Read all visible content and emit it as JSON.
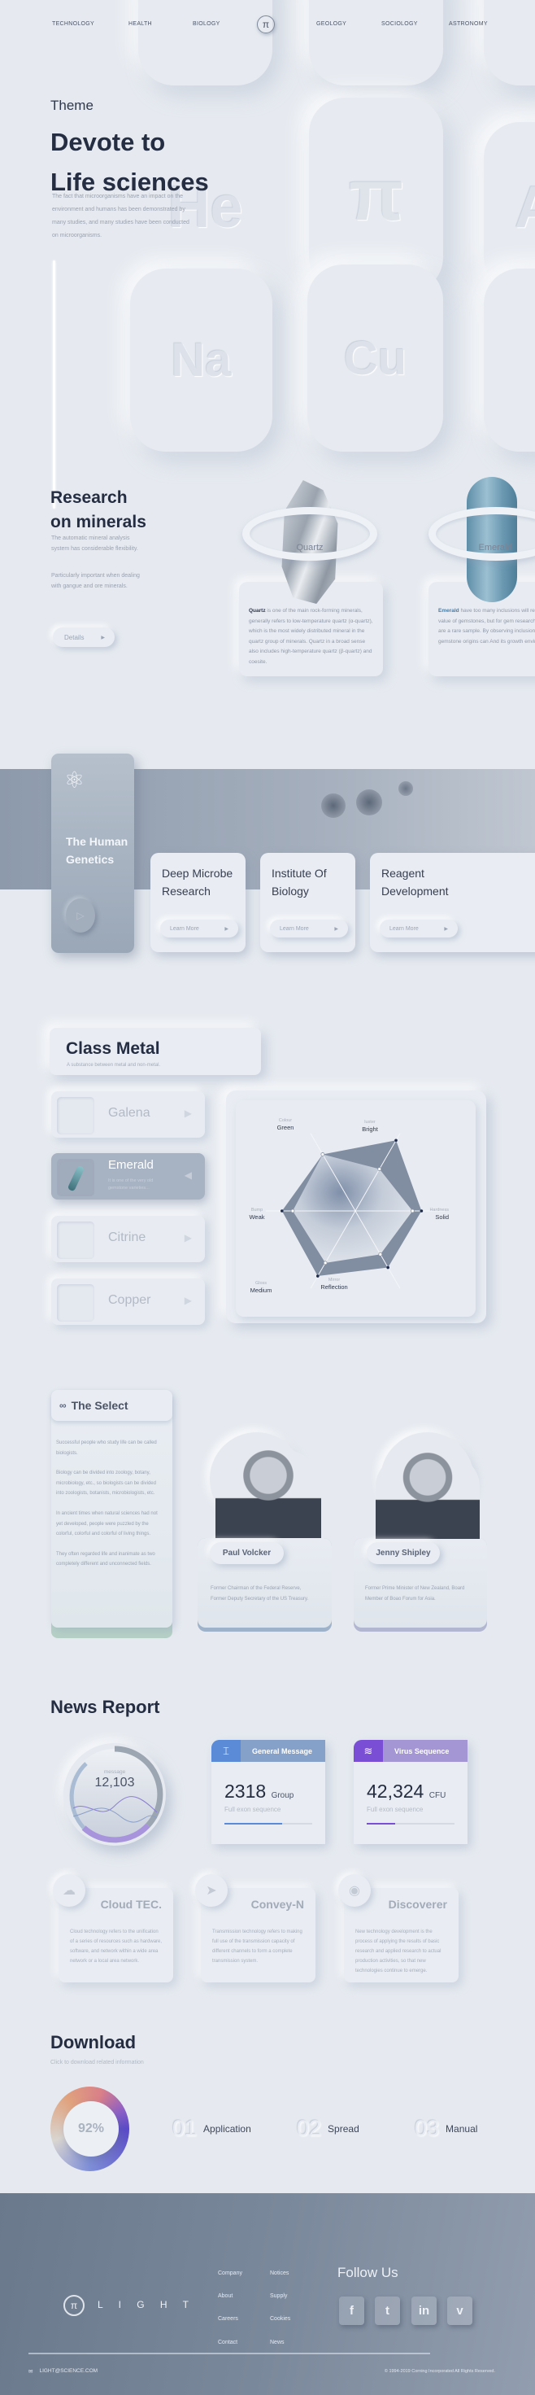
{
  "nav": {
    "left": [
      "TECHNOLOGY",
      "HEALTH",
      "BIOLOGY"
    ],
    "logo": "π",
    "right": [
      "GEOLOGY",
      "SOCIOLOGY",
      "ASTRONOMY"
    ]
  },
  "hero": {
    "eyebrow": "Theme",
    "title_line1": "Devote to",
    "title_line2": "Life sciences",
    "body": "The fact that microorganisms have an impact on the environment and humans has been demonstrated by many studies, and many studies have been conducted on microorganisms.",
    "tiles": [
      "He",
      "π",
      "A",
      "Na",
      "Cu"
    ]
  },
  "minerals": {
    "title_line1": "Research",
    "title_line2": "on minerals",
    "p1": "The automatic mineral analysis system has considerable flexibility.",
    "p2": "Particularly important when dealing with gangue and ore minerals.",
    "details": "Details",
    "arrow": "▶",
    "cards": [
      {
        "label": "Quartz",
        "lead": "Quartz",
        "text": " is one of the main rock-forming minerals, generally refers to low-temperature quartz (α-quartz), which is the most widely distributed mineral in the quartz group of minerals. Quartz in a broad sense also includes high-temperature quartz (β-quartz) and coesite."
      },
      {
        "label": "Emerald",
        "lead": "Emerald",
        "text": " have too many inclusions will reduce the value of gemstones, but for gem research, inclusions are a rare sample. By observing inclusions, different gemstone origins can And its growth environment."
      }
    ]
  },
  "genetics": {
    "title_line1": "The Human",
    "title_line2": "Genetics",
    "cards": [
      {
        "title_line1": "Deep Microbe",
        "title_line2": "Research",
        "button": "Learn More"
      },
      {
        "title_line1": "Institute Of",
        "title_line2": "Biology",
        "button": "Learn More"
      },
      {
        "title_line1": "Reagent",
        "title_line2": "Development",
        "button": "Learn More"
      }
    ]
  },
  "class_metal": {
    "title": "Class Metal",
    "subtitle": "A substance between metal and non-metal.",
    "items": [
      {
        "name": "Galena"
      },
      {
        "name": "Emerald",
        "desc": "It is one of the very old gemstone varieties..."
      },
      {
        "name": "Citrine"
      },
      {
        "name": "Copper"
      }
    ],
    "selected": "Emerald",
    "radar": {
      "axes": [
        {
          "label": "Colour",
          "value": "Green"
        },
        {
          "label": "luster",
          "value": "Bright"
        },
        {
          "label": "Hardness",
          "value": "Solid"
        },
        {
          "label": "Mirror",
          "value": "Reflection"
        },
        {
          "label": "Gloss",
          "value": "Medium"
        },
        {
          "label": "Bump",
          "value": "Weak"
        }
      ],
      "outer": [
        73,
        91,
        74,
        73,
        84,
        82
      ],
      "inner": [
        73,
        54,
        64,
        56,
        67,
        70
      ],
      "outer_color": "#6f7d93",
      "dot_color": "#1e2a4a"
    }
  },
  "select": {
    "title": "The Select",
    "paragraphs": [
      "Successful people who study life can be called biologists.",
      "Biology can be divided into zoology, botany, microbiology, etc., so biologists can be divided into zoologists, botanists, microbiologists, etc.",
      "In ancient times when natural sciences had not yet developed, people were puzzled by the colorful, colorful and colorful of living things.",
      "They often regarded life and inanimate as two completely different and unconnected fields."
    ],
    "people": [
      {
        "name": "Paul Volcker",
        "desc": "Former Chairman of the Federal Reserve, Former Deputy Secretary of the US Treasury."
      },
      {
        "name": "Jenny Shipley",
        "desc": "Former Prime Minister of New Zealand, Board Member of Boao Forum for Asia."
      }
    ]
  },
  "news": {
    "title": "News Report",
    "gauge": {
      "label": "message",
      "value": "12,103"
    },
    "stats": [
      {
        "title": "General Message",
        "value": "2318",
        "unit": "Group",
        "sub": "Full exon sequence",
        "progress": 0.66,
        "color": "#5b8bd6",
        "header": "#85a1c9"
      },
      {
        "title": "Virus Sequence",
        "value": "42,324",
        "unit": "CFU",
        "sub": "Full exon sequence",
        "progress": 0.32,
        "color": "#7a4fd6",
        "header": "#a495d4"
      }
    ],
    "tech": [
      {
        "title": "Cloud TEC.",
        "icon": "cloud-icon",
        "text": "Cloud technology refers to the unification of a series of resources such as hardware, software, and network within a wide area network or a local area network."
      },
      {
        "title": "Convey-N",
        "icon": "send-icon",
        "text": "Transmission technology refers to making full use of the transmission capacity of different channels to form a complete transmission system."
      },
      {
        "title": "Discoverer",
        "icon": "lens-icon",
        "text": "New technology development is the process of applying the results of basic research and applied research to actual production activities, so that new technologies continue to emerge."
      }
    ]
  },
  "download": {
    "title": "Download",
    "subtitle": "Click to download related information",
    "progress": "92%",
    "items": [
      {
        "num": "01",
        "label": "Application"
      },
      {
        "num": "02",
        "label": "Spread"
      },
      {
        "num": "03",
        "label": "Manual"
      }
    ]
  },
  "footer": {
    "brand": "L I G H T",
    "logo": "π",
    "links_col1": [
      "Company",
      "About",
      "Careers",
      "Contact"
    ],
    "links_col2": [
      "Notices",
      "Supply",
      "Cookies",
      "News"
    ],
    "follow": "Follow Us",
    "social": [
      "f",
      "t",
      "in",
      "v"
    ],
    "email": "LIGHT@SCIENCE.COM",
    "copyright": "© 1994-2019 Corning Incorporated All Rights Reserved."
  }
}
